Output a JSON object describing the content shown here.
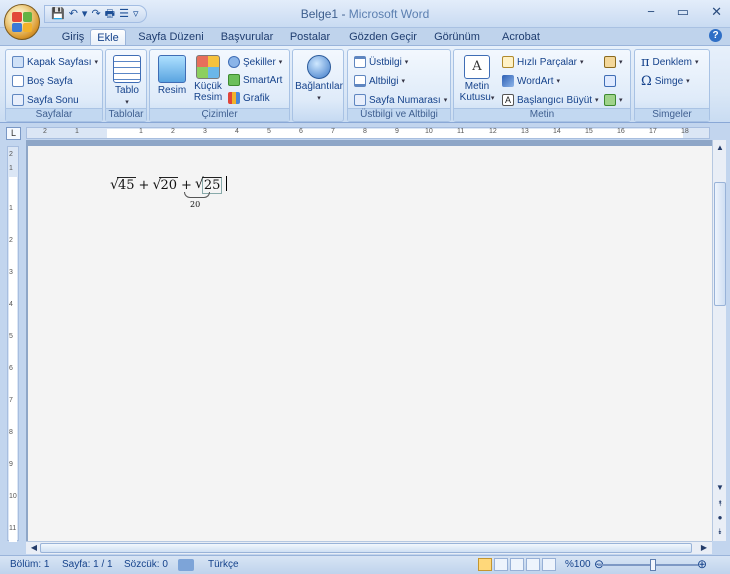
{
  "window": {
    "doc_name": "Belge1",
    "separator": " - ",
    "app_name": "Microsoft Word",
    "controls": {
      "minimize": "−",
      "maximize": "▭",
      "close": "✕"
    }
  },
  "qat": {
    "save": "💾",
    "undo": "↶",
    "undo_menu": "▾",
    "redo": "↷",
    "print": "🖶",
    "format": "☰",
    "customize": "▿"
  },
  "tabs": [
    "Giriş",
    "Ekle",
    "Sayfa Düzeni",
    "Başvurular",
    "Postalar",
    "Gözden Geçir",
    "Görünüm",
    "Acrobat"
  ],
  "active_tab": "Ekle",
  "help": "?",
  "ribbon": {
    "sayfalar": {
      "label": "Sayfalar",
      "items": [
        "Kapak Sayfası",
        "Boş Sayfa",
        "Sayfa Sonu"
      ]
    },
    "tablolar": {
      "label": "Tablolar",
      "tablo": "Tablo"
    },
    "cizimler": {
      "label": "Çizimler",
      "resim": "Resim",
      "kucuk_resim_1": "Küçük",
      "kucuk_resim_2": "Resim",
      "sekiller": "Şekiller",
      "smartart": "SmartArt",
      "grafik": "Grafik"
    },
    "baglantilar": {
      "label": "Bağlantılar"
    },
    "ustbilgi": {
      "label": "Üstbilgi ve Altbilgi",
      "items": [
        "Üstbilgi",
        "Altbilgi",
        "Sayfa Numarası"
      ]
    },
    "metin": {
      "label": "Metin",
      "metin_kutusu_1": "Metin",
      "metin_kutusu_2": "Kutusu",
      "items": [
        "Hızlı Parçalar",
        "WordArt",
        "Başlangıcı Büyüt"
      ]
    },
    "simgeler": {
      "label": "Simgeler",
      "denklem": "Denklem",
      "simge": "Simge"
    }
  },
  "ruler": {
    "h_ticks": [
      "2",
      "1",
      "1",
      "2",
      "3",
      "4",
      "5",
      "6",
      "7",
      "8",
      "9",
      "10",
      "11",
      "12",
      "13",
      "14",
      "15",
      "16",
      "17",
      "18"
    ],
    "v_ticks": [
      "2",
      "1",
      "1",
      "2",
      "3",
      "4",
      "5",
      "6",
      "7",
      "8",
      "9",
      "10",
      "11"
    ]
  },
  "document": {
    "equation": {
      "t1": "45",
      "plus": "+",
      "t2": "20",
      "t3": "25",
      "under": "20"
    }
  },
  "statusbar": {
    "bolum": "Bölüm: 1",
    "sayfa": "Sayfa: 1 / 1",
    "sozcuk": "Sözcük: 0",
    "dil": "Türkçe",
    "zoom": "%100"
  }
}
